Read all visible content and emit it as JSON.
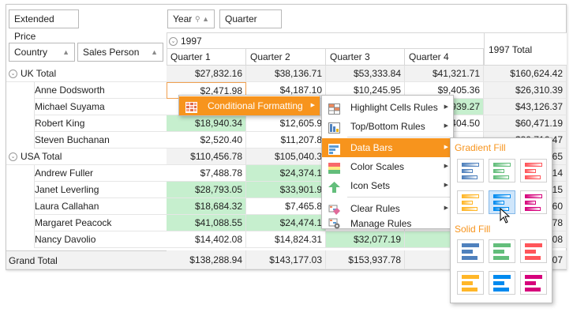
{
  "fields": {
    "data_field": "Extended Price",
    "column_fields": [
      "Year",
      "Quarter"
    ],
    "row_fields": [
      "Country",
      "Sales Person"
    ]
  },
  "column_header": {
    "year": "1997",
    "quarters": [
      "Quarter 1",
      "Quarter 2",
      "Quarter 3",
      "Quarter 4"
    ],
    "year_total": "1997 Total"
  },
  "rows": [
    {
      "label": "UK Total",
      "kind": "total",
      "values": [
        "$27,832.16",
        "$38,136.71",
        "$53,333.84",
        "$41,321.71",
        "$160,624.42"
      ]
    },
    {
      "label": "Anne Dodsworth",
      "kind": "person",
      "values": [
        "$2,471.98",
        "$4,187.10",
        "$10,245.95",
        "$9,405.36",
        "$26,310.39"
      ]
    },
    {
      "label": "Michael Suyama",
      "kind": "person",
      "values": [
        "",
        "",
        "",
        "939.27",
        "$43,126.37"
      ]
    },
    {
      "label": "Robert King",
      "kind": "person",
      "values": [
        "$18,940.34",
        "$12,605.9",
        "",
        "404.50",
        "$60,471.19"
      ]
    },
    {
      "label": "Steven Buchanan",
      "kind": "person",
      "values": [
        "$2,520.40",
        "$11,207.8",
        "",
        "",
        "$30,716.47"
      ]
    },
    {
      "label": "USA Total",
      "kind": "total",
      "values": [
        "$110,456.78",
        "$105,040.3",
        "",
        "",
        "$371,341.65"
      ]
    },
    {
      "label": "Andrew Fuller",
      "kind": "person",
      "values": [
        "$7,488.78",
        "$24,374.1",
        "",
        "",
        "$70,444.14"
      ]
    },
    {
      "label": "Janet Leverling",
      "kind": "person",
      "values": [
        "$28,793.05",
        "$33,901.9",
        "",
        "",
        "$108,026.15"
      ]
    },
    {
      "label": "Laura Callahan",
      "kind": "person",
      "values": [
        "$18,684.32",
        "$7,465.8",
        "",
        "",
        "$56,032.60"
      ]
    },
    {
      "label": "Margaret Peacock",
      "kind": "person",
      "values": [
        "$41,088.55",
        "$24,474.1",
        "",
        "",
        "$128,809.78"
      ]
    },
    {
      "label": "Nancy Davolio",
      "kind": "person",
      "values": [
        "$14,402.08",
        "$14,824.31",
        "$32,077.19",
        "$31",
        "$93,148.08"
      ]
    }
  ],
  "grand_total": {
    "label": "Grand Total",
    "values": [
      "$138,288.94",
      "$143,177.03",
      "$153,937.78",
      "$181",
      "$531,966.07"
    ]
  },
  "green_cells": [
    [
      3,
      0
    ],
    [
      6,
      1
    ],
    [
      7,
      0
    ],
    [
      7,
      1
    ],
    [
      8,
      0
    ],
    [
      9,
      0
    ],
    [
      9,
      1
    ],
    [
      10,
      2
    ],
    [
      10,
      3
    ],
    [
      2,
      3
    ]
  ],
  "context_menu": {
    "item": "Conditional Formatting"
  },
  "cf_submenu": {
    "items": [
      "Highlight Cells Rules",
      "Top/Bottom Rules",
      "Data Bars",
      "Color Scales",
      "Icon Sets",
      "Clear Rules",
      "Manage Rules"
    ]
  },
  "databars_gallery": {
    "gradient_title": "Gradient Fill",
    "solid_title": "Solid Fill",
    "colors": [
      "#4f81bd",
      "#63be7b",
      "#ff555a",
      "#ffb628",
      "#008aef",
      "#d6007b"
    ]
  }
}
